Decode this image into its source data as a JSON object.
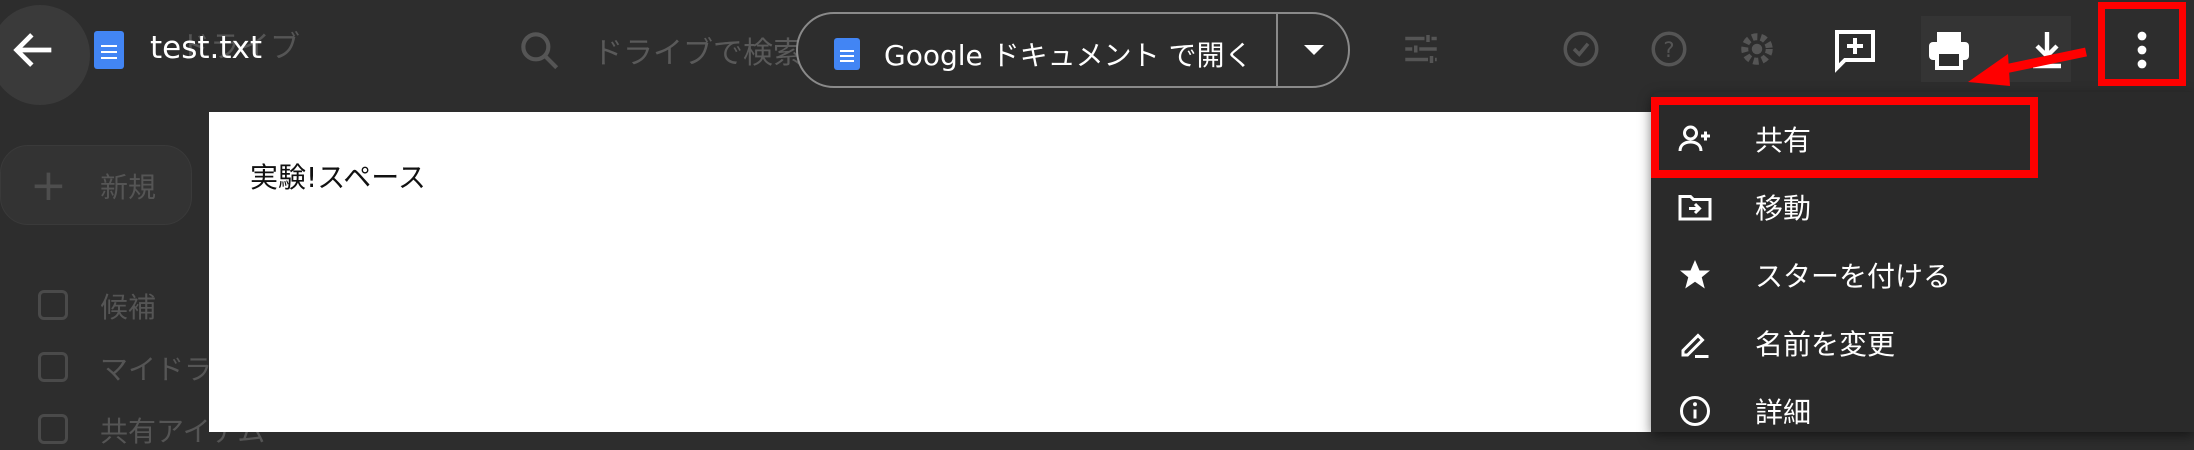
{
  "background": {
    "drive_title": "ドライブ",
    "search_placeholder": "ドライブで検索",
    "new_button_label": "新規",
    "nav_items": [
      "候補",
      "マイドライブ",
      "共有アイテム"
    ]
  },
  "topbar": {
    "file_name": "test.txt",
    "open_with_label": "Google ドキュメント で開く"
  },
  "document": {
    "content": "実験!スペース"
  },
  "menu": {
    "items": [
      {
        "label": "共有",
        "icon": "person-add-icon"
      },
      {
        "label": "移動",
        "icon": "move-folder-icon"
      },
      {
        "label": "スターを付ける",
        "icon": "star-icon"
      },
      {
        "label": "名前を変更",
        "icon": "rename-pen-icon"
      },
      {
        "label": "詳細",
        "icon": "info-icon"
      }
    ]
  },
  "colors": {
    "highlight": "#ff0000",
    "doc_blue": "#4285f4",
    "overlay_bg": "#2d2d2d"
  }
}
